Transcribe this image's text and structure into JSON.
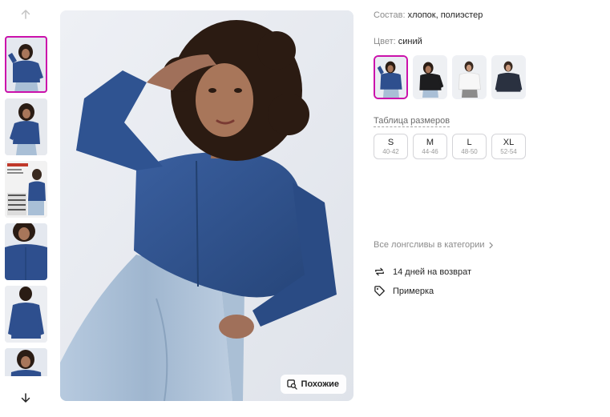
{
  "gallery": {
    "up_icon": "arrow-up-icon",
    "down_icon": "arrow-down-icon",
    "thumbnails": [
      {
        "kind": "model-front",
        "selected": true
      },
      {
        "kind": "model-side",
        "selected": false
      },
      {
        "kind": "size-chart-collage",
        "selected": false
      },
      {
        "kind": "detail-closeup",
        "selected": false
      },
      {
        "kind": "back-view",
        "selected": false
      },
      {
        "kind": "model-cropped",
        "selected": false
      }
    ],
    "similar_button_label": "Похожие",
    "similar_icon": "similar-search-icon"
  },
  "product": {
    "composition_label": "Состав:",
    "composition_value": "хлопок, полиэстер",
    "color_label": "Цвет:",
    "color_value": "синий",
    "color_options": [
      {
        "name": "синий",
        "selected": true,
        "garment": "#2e4f8e"
      },
      {
        "name": "черный",
        "selected": false,
        "garment": "#1d1d1f"
      },
      {
        "name": "белый",
        "selected": false,
        "garment": "#ececec"
      },
      {
        "name": "темно-синий",
        "selected": false,
        "garment": "#2a3140"
      }
    ],
    "size_table_link": "Таблица размеров",
    "sizes": [
      {
        "name": "S",
        "range": "40-42"
      },
      {
        "name": "M",
        "range": "44-46"
      },
      {
        "name": "L",
        "range": "48-50"
      },
      {
        "name": "XL",
        "range": "52-54"
      }
    ],
    "category_link": "Все лонгсливы в категории",
    "perks": [
      {
        "icon": "return-arrows-icon",
        "label": "14 дней на возврат"
      },
      {
        "icon": "tag-icon",
        "label": "Примерка"
      }
    ]
  },
  "colors": {
    "accent": "#cb11ab",
    "garment_blue": "#2e4f8e",
    "denim": "#a9bfd6",
    "photo_bg": "#e6e9ef"
  }
}
